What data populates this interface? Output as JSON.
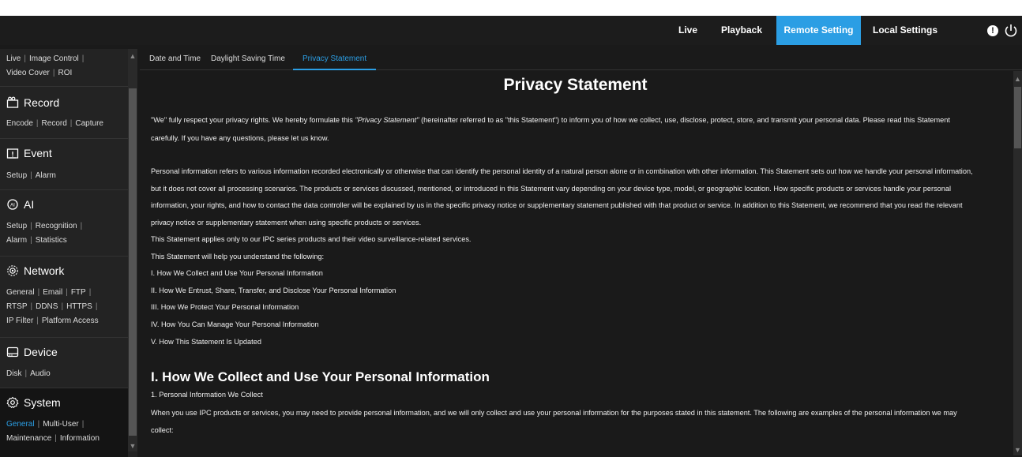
{
  "nav": {
    "live": "Live",
    "playback": "Playback",
    "remote_setting": "Remote Setting",
    "local_settings": "Local Settings",
    "alert_icon_glyph": "!"
  },
  "sidebar": {
    "live_links": [
      "Live",
      "Image Control"
    ],
    "live_links2": [
      "Video Cover",
      "ROI"
    ],
    "record": {
      "title": "Record",
      "links": [
        "Encode",
        "Record",
        "Capture"
      ]
    },
    "event": {
      "title": "Event",
      "links": [
        "Setup",
        "Alarm"
      ]
    },
    "ai": {
      "title": "AI",
      "links1": [
        "Setup",
        "Recognition"
      ],
      "links2": [
        "Alarm",
        "Statistics"
      ]
    },
    "network": {
      "title": "Network",
      "links1": [
        "General",
        "Email",
        "FTP"
      ],
      "links2": [
        "RTSP",
        "DDNS",
        "HTTPS"
      ],
      "links3": [
        "IP Filter",
        "Platform Access"
      ]
    },
    "device": {
      "title": "Device",
      "links": [
        "Disk",
        "Audio"
      ]
    },
    "system": {
      "title": "System",
      "links1": [
        "General",
        "Multi-User"
      ],
      "links2": [
        "Maintenance",
        "Information"
      ]
    }
  },
  "tabs": [
    "Date and Time",
    "Daylight Saving Time",
    "Privacy Statement"
  ],
  "doc": {
    "title": "Privacy Statement",
    "intro_a": "\"We\" fully respect your privacy rights. We hereby formulate this ",
    "intro_em": "\"Privacy Statement\"",
    "intro_b": " (hereinafter referred to as \"this Statement\") to inform you of how we collect, use, disclose, protect, store, and transmit your personal data. Please read this Statement",
    "intro_2": "carefully. If you have any questions, please let us know.",
    "para1_1": "Personal information refers to various information recorded electronically or otherwise that can identify the personal identity of a natural person alone or in combination with other information. This Statement sets out how we handle your personal information,",
    "para1_2": "but it does not cover all processing scenarios. The products or services discussed, mentioned, or introduced in this Statement vary depending on your device type, model, or geographic location. How specific products or services handle your personal",
    "para1_3": "information, your rights, and how to contact the data controller will be explained by us in the specific privacy notice or supplementary statement published with that product or service. In addition to this Statement, we recommend that you read the relevant",
    "para1_4": "privacy notice or supplementary statement when using specific products or services.",
    "applies": "This Statement applies only to our IPC series products and their video surveillance-related services.",
    "help": "This Statement will help you understand the following:",
    "toc": [
      "I. How We Collect and Use Your Personal Information",
      "II. How We Entrust, Share, Transfer, and Disclose Your Personal Information",
      "III. How We Protect Your Personal Information",
      "IV. How You Can Manage Your Personal Information",
      "V. How This Statement Is Updated"
    ],
    "section1_title": "I. How We Collect and Use Your Personal Information",
    "section1_sub": "1. Personal Information We Collect",
    "section1_p1": "When you use IPC products or services, you may need to provide personal information, and we will only collect and use your personal information for the purposes stated in this statement. The following are examples of the personal information we may",
    "section1_p2": "collect:"
  }
}
